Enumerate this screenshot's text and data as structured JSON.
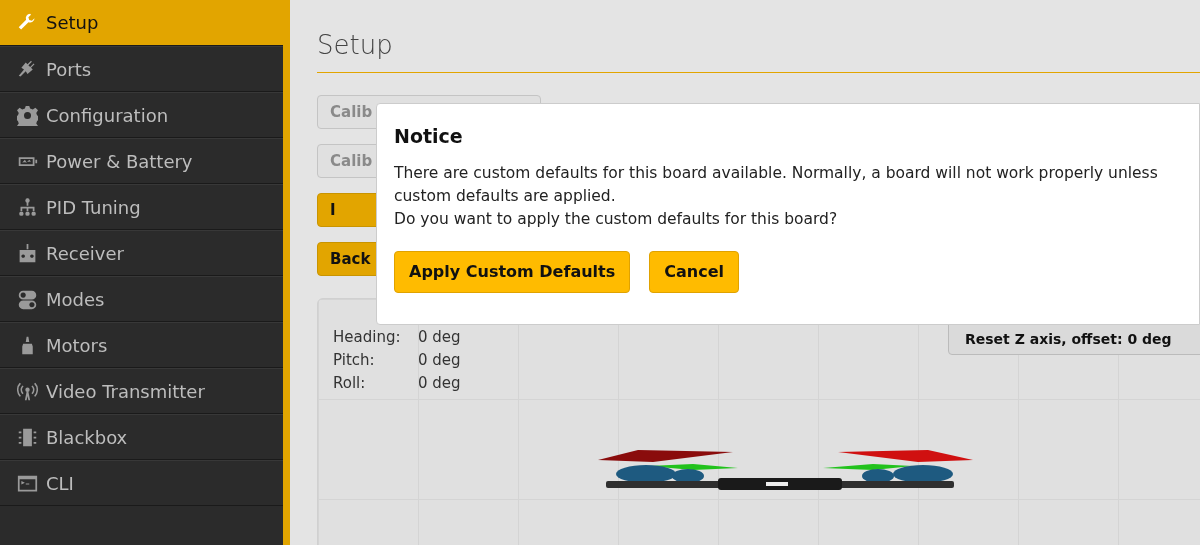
{
  "sidebar": {
    "items": [
      {
        "label": "Setup",
        "selected": true
      },
      {
        "label": "Ports",
        "selected": false
      },
      {
        "label": "Configuration",
        "selected": false
      },
      {
        "label": "Power & Battery",
        "selected": false
      },
      {
        "label": "PID Tuning",
        "selected": false
      },
      {
        "label": "Receiver",
        "selected": false
      },
      {
        "label": "Modes",
        "selected": false
      },
      {
        "label": "Motors",
        "selected": false
      },
      {
        "label": "Video Transmitter",
        "selected": false
      },
      {
        "label": "Blackbox",
        "selected": false
      },
      {
        "label": "CLI",
        "selected": false
      }
    ]
  },
  "page": {
    "title": "Setup",
    "buttons": [
      {
        "label": "Calib",
        "kind": "disabled"
      },
      {
        "label": "Calib",
        "kind": "disabled"
      },
      {
        "label": "I",
        "kind": "primary"
      },
      {
        "label": "Back",
        "kind": "primary"
      }
    ],
    "attitude": [
      {
        "label": "Heading:",
        "value": "0 deg"
      },
      {
        "label": "Pitch:",
        "value": "0 deg"
      },
      {
        "label": "Roll:",
        "value": "0 deg"
      }
    ],
    "reset_button": "Reset Z axis, offset: 0 deg"
  },
  "dialog": {
    "title": "Notice",
    "lines": [
      "There are custom defaults for this board available. Normally, a board will not work properly unless custom defaults are applied.",
      "Do you want to apply the custom defaults for this board?"
    ],
    "buttons": [
      "Apply Custom Defaults",
      "Cancel"
    ]
  }
}
